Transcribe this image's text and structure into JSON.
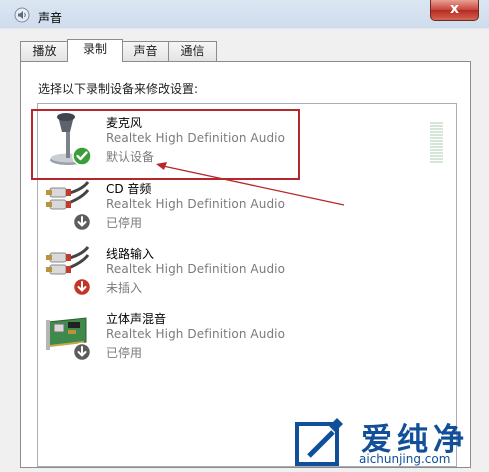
{
  "window": {
    "title": "声音",
    "title_icon": "speaker-icon",
    "close_label": "x"
  },
  "tabs": [
    {
      "label": "播放",
      "active": false
    },
    {
      "label": "录制",
      "active": true
    },
    {
      "label": "声音",
      "active": false
    },
    {
      "label": "通信",
      "active": false
    }
  ],
  "panel": {
    "instruction": "选择以下录制设备来修改设置:"
  },
  "devices": [
    {
      "name": "麦克风",
      "driver": "Realtek High Definition Audio",
      "status": "默认设备",
      "icon": "microphone-icon",
      "badge": "default-check-icon"
    },
    {
      "name": "CD 音频",
      "driver": "Realtek High Definition Audio",
      "status": "已停用",
      "icon": "audio-cable-icon",
      "badge": "disabled-arrow-icon"
    },
    {
      "name": "线路输入",
      "driver": "Realtek High Definition Audio",
      "status": "未插入",
      "icon": "audio-cable-icon",
      "badge": "unplugged-arrow-icon"
    },
    {
      "name": "立体声混音",
      "driver": "Realtek High Definition Audio",
      "status": "已停用",
      "icon": "sound-card-icon",
      "badge": "disabled-arrow-icon"
    }
  ],
  "watermark": {
    "text": "爱纯净",
    "url": "aichunjing.com",
    "logo": "aichunjing-logo-icon"
  },
  "colors": {
    "annotation_red": "#b7262d",
    "watermark_blue": "#114f9b",
    "secondary_text": "#7b7b7b"
  }
}
